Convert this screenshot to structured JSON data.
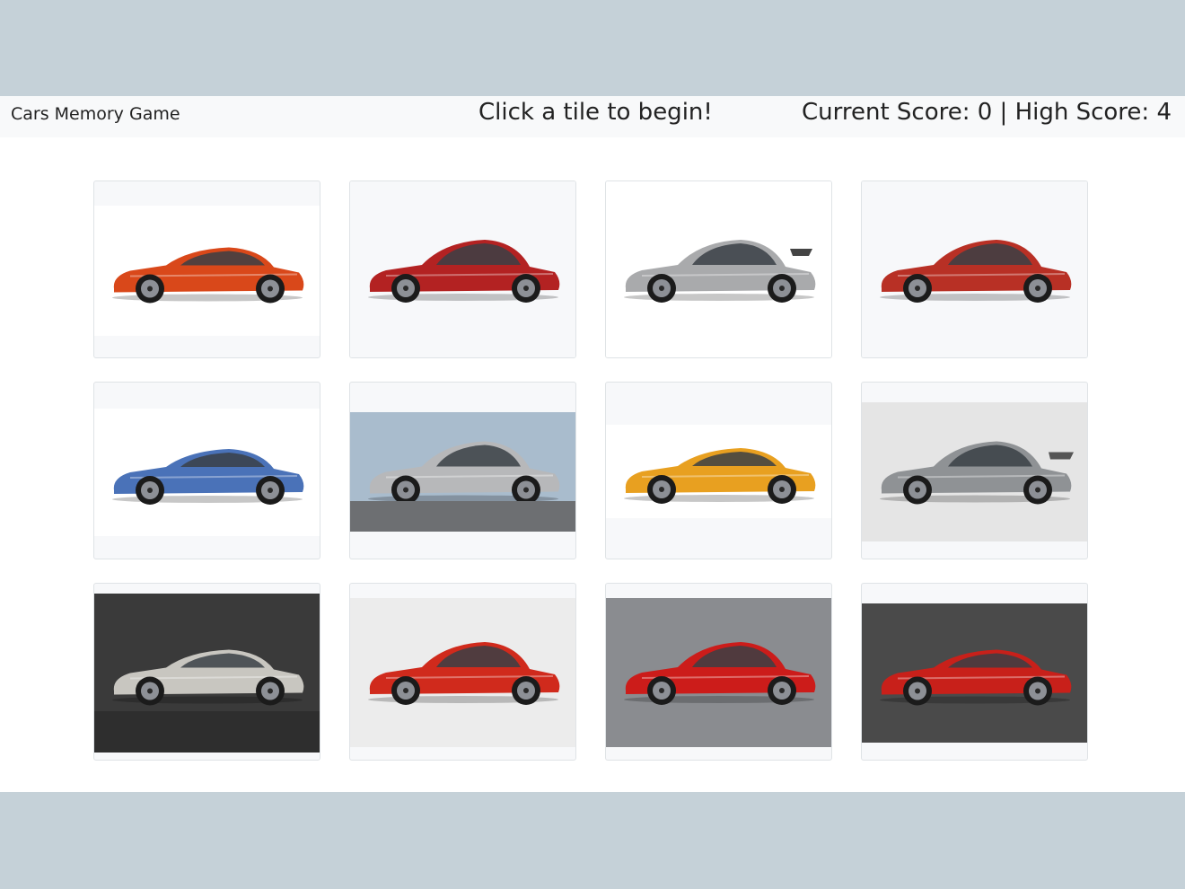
{
  "header": {
    "title": "Cars Memory Game",
    "message": "Click a tile to begin!",
    "score_text": "Current Score: 0 | High Score: 4"
  },
  "tiles": [
    {
      "car": "orange-supercar-wedge",
      "body_color": "#d9481a",
      "background": "#ffffff"
    },
    {
      "car": "red-sports-coupe",
      "body_color": "#b32222",
      "background": "#f7f8fa"
    },
    {
      "car": "silver-gt-with-wing",
      "body_color": "#a9aaac",
      "background": "#ffffff"
    },
    {
      "car": "red-roadster-soft-top",
      "body_color": "#b83025",
      "background": "#f7f8fa"
    },
    {
      "car": "blue-silver-hypercar",
      "body_color": "#4a72b8",
      "background": "#ffffff"
    },
    {
      "car": "silver-convertible",
      "body_color": "#b7b8ba",
      "background": "#a9bccd"
    },
    {
      "car": "orange-mid-engine-coupe",
      "body_color": "#e8a020",
      "background": "#ffffff"
    },
    {
      "car": "grey-hatchback-with-wing",
      "body_color": "#8f9295",
      "background": "#e5e5e5"
    },
    {
      "car": "silver-hypercar-studio",
      "body_color": "#c8c6c0",
      "background": "#3a3a3a"
    },
    {
      "car": "red-classic-coupe",
      "body_color": "#d02a1c",
      "background": "#ececec"
    },
    {
      "car": "red-concept-coupe",
      "body_color": "#cc1c1a",
      "background": "#8a8c90"
    },
    {
      "car": "red-hypercar-dark-studio",
      "body_color": "#c8201a",
      "background": "#4a4a4a"
    }
  ]
}
